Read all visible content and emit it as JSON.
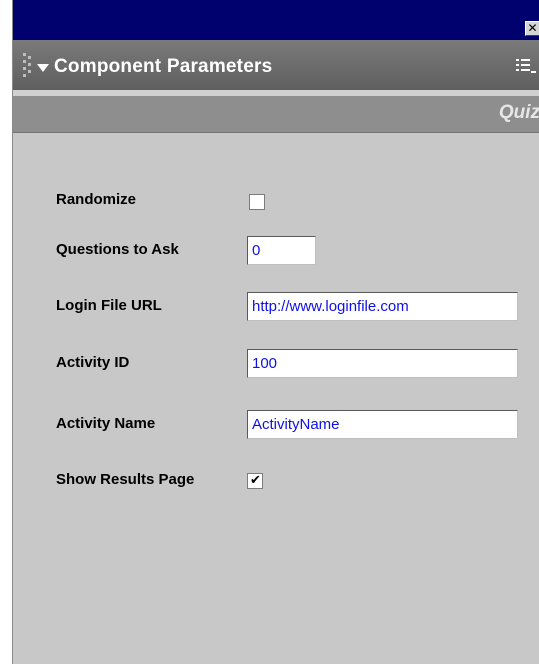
{
  "window": {
    "close_glyph": "✕"
  },
  "panel": {
    "title": "Component Parameters",
    "component_name": "Quiz"
  },
  "params": {
    "randomize": {
      "label": "Randomize",
      "checked": false
    },
    "questions_to_ask": {
      "label": "Questions to Ask",
      "value": "0"
    },
    "login_file_url": {
      "label": "Login File URL",
      "value": "http://www.loginfile.com"
    },
    "activity_id": {
      "label": "Activity ID",
      "value": "100"
    },
    "activity_name": {
      "label": "Activity Name",
      "value": "ActivityName"
    },
    "show_results_page": {
      "label": "Show Results Page",
      "checked": true,
      "check_glyph": "✔"
    }
  },
  "colors": {
    "titlebar": "#00006e",
    "panel_header": "#6b6b6b",
    "panel_body": "#c8c8c8",
    "input_text": "#1010e8"
  },
  "icons": {
    "grip": "gripper-icon",
    "collapse": "triangle-down-icon",
    "options": "panel-options-menu-icon",
    "close": "close-icon"
  }
}
